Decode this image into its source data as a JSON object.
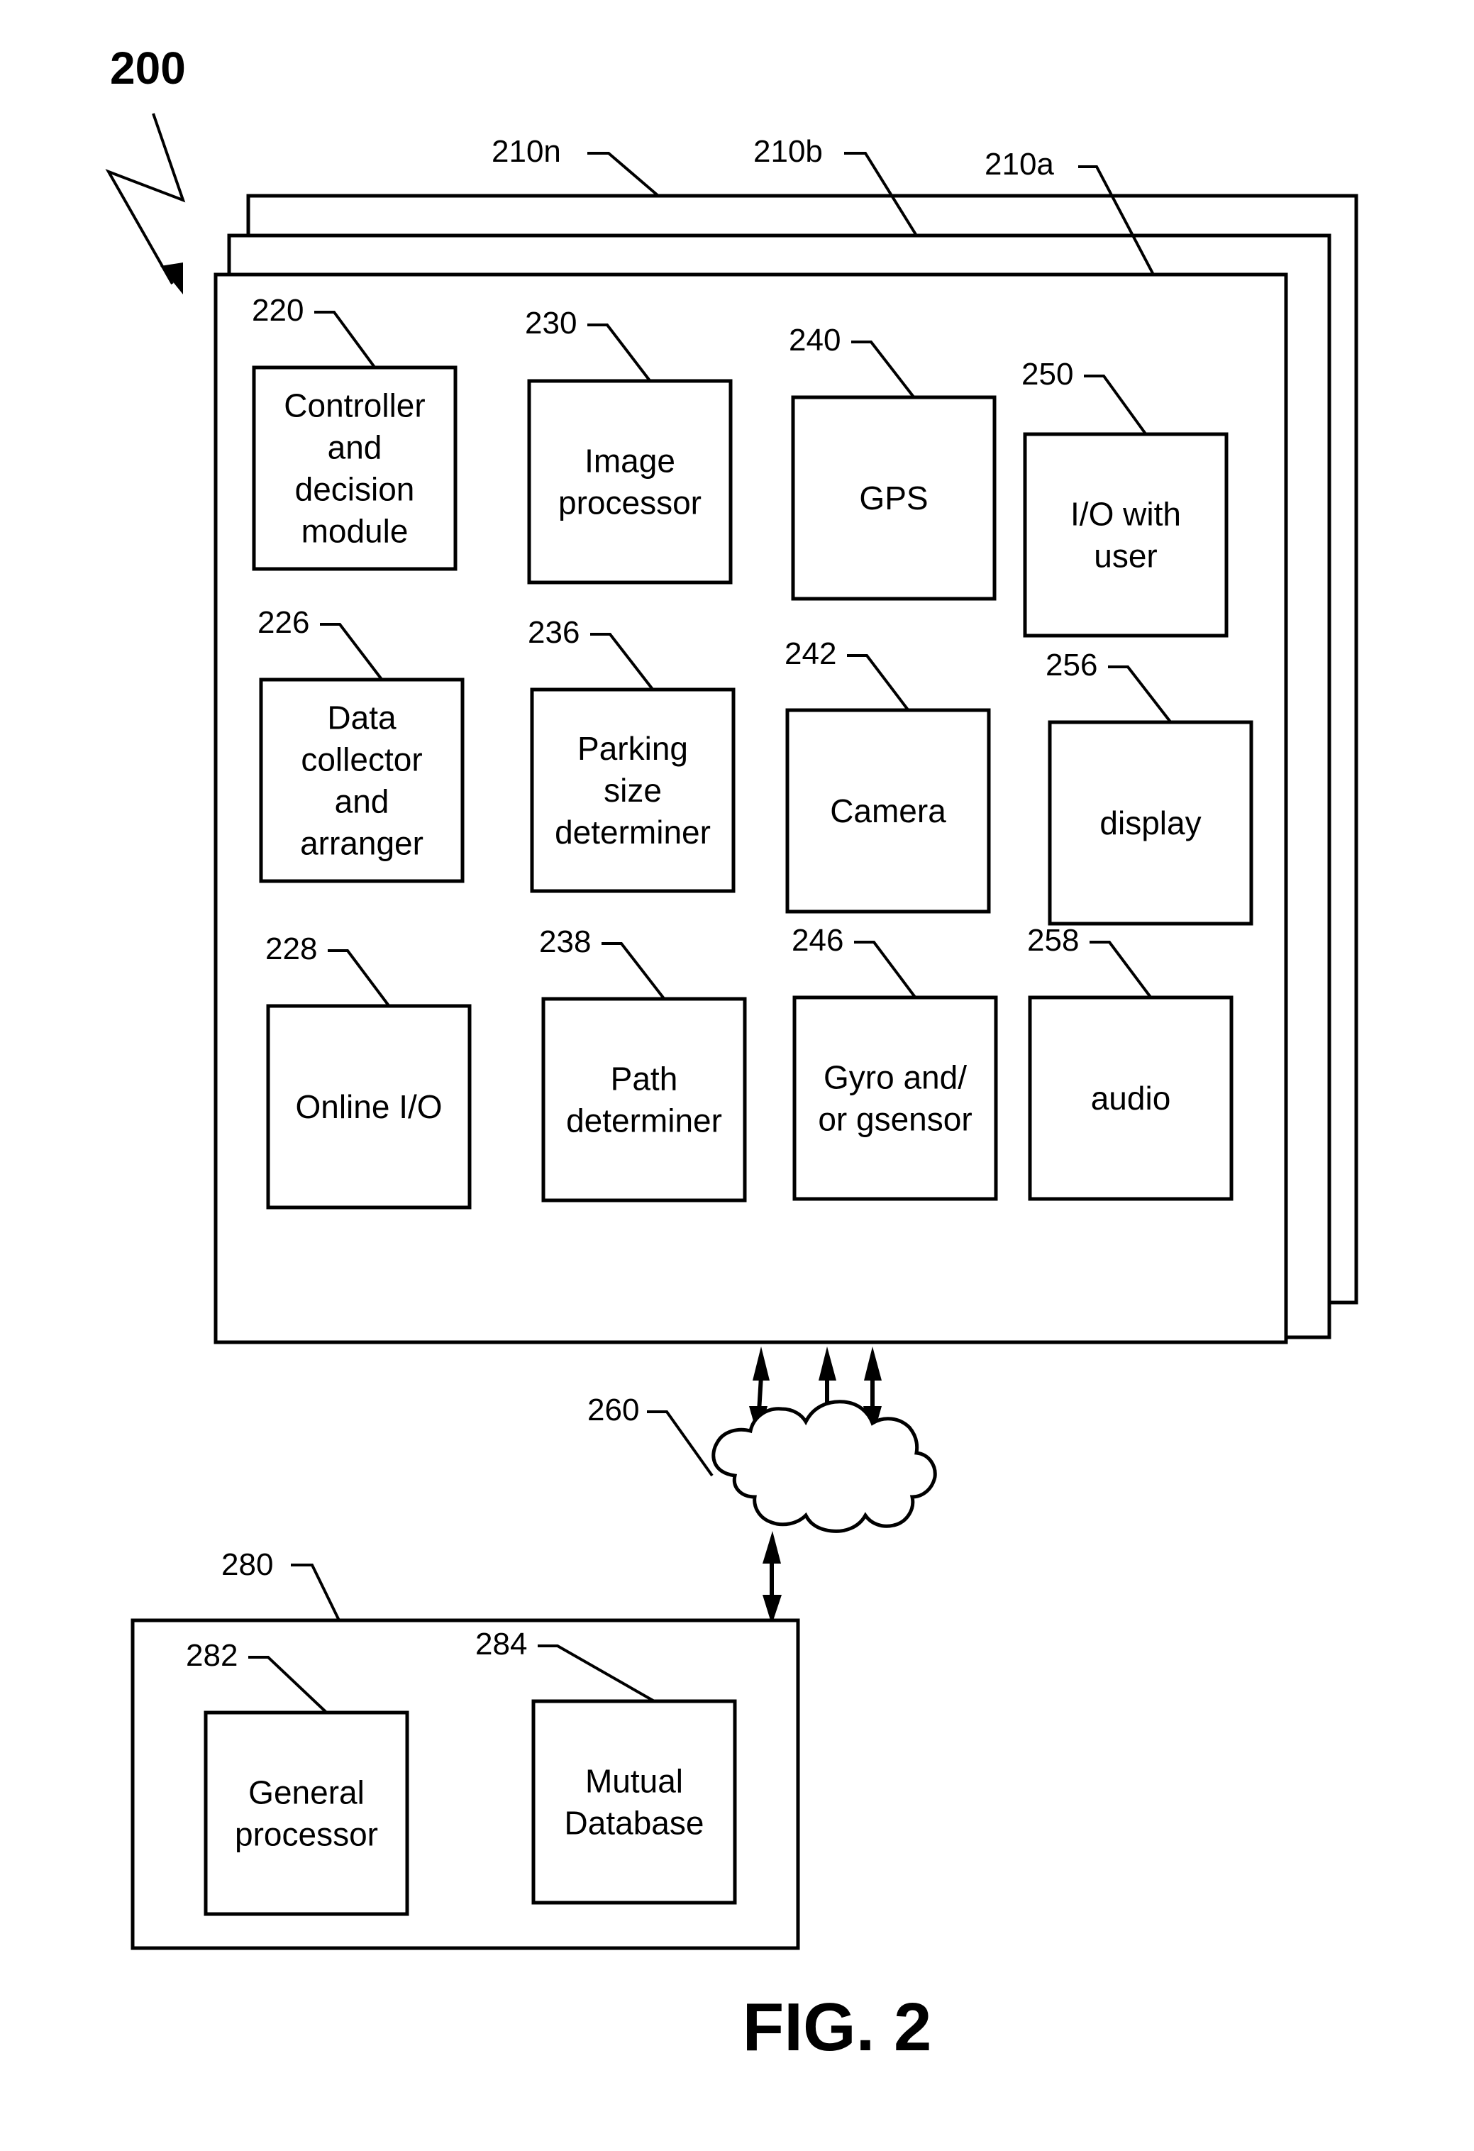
{
  "figure": {
    "number_label": "200",
    "caption": "FIG. 2"
  },
  "device_frames": [
    {
      "ref": "210n"
    },
    {
      "ref": "210b"
    },
    {
      "ref": "210a"
    }
  ],
  "components": [
    {
      "ref": "220",
      "lines": [
        "Controller",
        "and",
        "decision",
        "module"
      ]
    },
    {
      "ref": "230",
      "lines": [
        "Image",
        "processor"
      ]
    },
    {
      "ref": "240",
      "lines": [
        "GPS"
      ]
    },
    {
      "ref": "250",
      "lines": [
        "I/O with",
        "user"
      ]
    },
    {
      "ref": "226",
      "lines": [
        "Data",
        "collector",
        "and",
        "arranger"
      ]
    },
    {
      "ref": "236",
      "lines": [
        "Parking",
        "size",
        "determiner"
      ]
    },
    {
      "ref": "242",
      "lines": [
        "Camera"
      ]
    },
    {
      "ref": "256",
      "lines": [
        "display"
      ]
    },
    {
      "ref": "228",
      "lines": [
        "Online I/O"
      ]
    },
    {
      "ref": "238",
      "lines": [
        "Path",
        "determiner"
      ]
    },
    {
      "ref": "246",
      "lines": [
        "Gyro and/",
        "or gsensor"
      ]
    },
    {
      "ref": "258",
      "lines": [
        "audio"
      ]
    }
  ],
  "network": {
    "ref": "260",
    "icon": "cloud-icon"
  },
  "server": {
    "ref": "280",
    "components": [
      {
        "ref": "282",
        "lines": [
          "General",
          "processor"
        ]
      },
      {
        "ref": "284",
        "lines": [
          "Mutual",
          "Database"
        ]
      }
    ]
  }
}
